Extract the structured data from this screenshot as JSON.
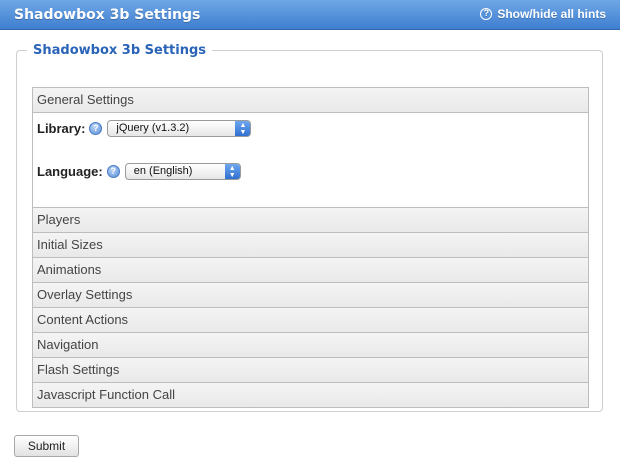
{
  "app": {
    "title": "Shadowbox 3b Settings",
    "hints_label": "Show/hide all hints"
  },
  "panel": {
    "title": "Shadowbox 3b Settings"
  },
  "sections": {
    "general": "General Settings",
    "players": "Players",
    "initial_sizes": "Initial Sizes",
    "animations": "Animations",
    "overlay": "Overlay Settings",
    "content_actions": "Content Actions",
    "navigation": "Navigation",
    "flash": "Flash Settings",
    "js_call": "Javascript Function Call"
  },
  "general": {
    "library_label": "Library:",
    "library_value": "jQuery (v1.3.2)",
    "language_label": "Language:",
    "language_value": "en (English)"
  },
  "actions": {
    "submit_label": "Submit"
  },
  "colors": {
    "titlebar": "#3f7fd0",
    "panel_title": "#2a64b8"
  },
  "icons": [
    "help-icon",
    "question-circle-icon",
    "select-arrow-icon"
  ]
}
